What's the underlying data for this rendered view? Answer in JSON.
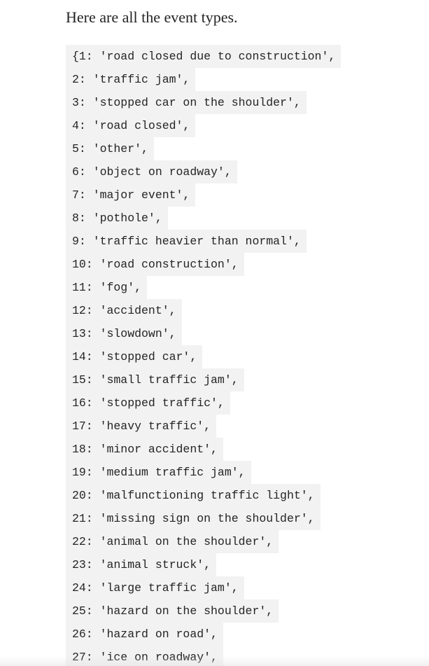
{
  "intro_text": "Here are all the event types.",
  "code_lines": [
    "{1: 'road closed due to construction',",
    "2: 'traffic jam',",
    "3: 'stopped car on the shoulder',",
    "4: 'road closed',",
    "5: 'other',",
    "6: 'object on roadway',",
    "7: 'major event',",
    "8: 'pothole',",
    "9: 'traffic heavier than normal',",
    "10: 'road construction',",
    "11: 'fog',",
    "12: 'accident',",
    "13: 'slowdown',",
    "14: 'stopped car',",
    "15: 'small traffic jam',",
    "16: 'stopped traffic',",
    "17: 'heavy traffic',",
    "18: 'minor accident',",
    "19: 'medium traffic jam',",
    "20: 'malfunctioning traffic light',",
    "21: 'missing sign on the shoulder',",
    "22: 'animal on the shoulder',",
    "23: 'animal struck',",
    "24: 'large traffic jam',",
    "25: 'hazard on the shoulder',",
    "26: 'hazard on road',",
    "27: 'ice on roadway',"
  ]
}
